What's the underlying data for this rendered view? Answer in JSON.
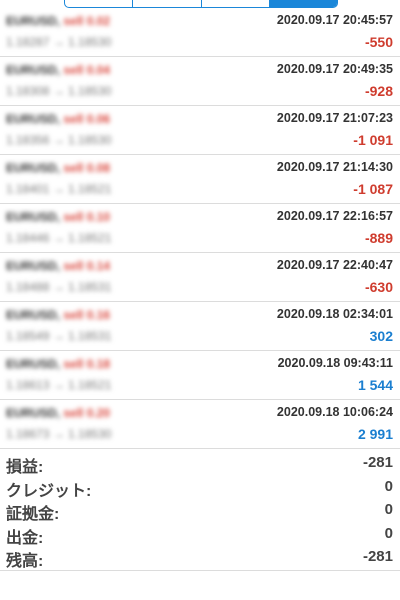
{
  "deals": [
    {
      "symbol": "EURUSD,",
      "side": "sell 0.02",
      "prices": "1.18287 → 1.18530",
      "time": "2020.09.17 20:45:57",
      "profit": "-550",
      "positive": false
    },
    {
      "symbol": "EURUSD,",
      "side": "sell 0.04",
      "prices": "1.18308 → 1.18530",
      "time": "2020.09.17 20:49:35",
      "profit": "-928",
      "positive": false
    },
    {
      "symbol": "EURUSD,",
      "side": "sell 0.06",
      "prices": "1.18356 → 1.18530",
      "time": "2020.09.17 21:07:23",
      "profit": "-1 091",
      "positive": false
    },
    {
      "symbol": "EURUSD,",
      "side": "sell 0.08",
      "prices": "1.18401 → 1.18521",
      "time": "2020.09.17 21:14:30",
      "profit": "-1 087",
      "positive": false
    },
    {
      "symbol": "EURUSD,",
      "side": "sell 0.10",
      "prices": "1.18446 → 1.18521",
      "time": "2020.09.17 22:16:57",
      "profit": "-889",
      "positive": false
    },
    {
      "symbol": "EURUSD,",
      "side": "sell 0.14",
      "prices": "1.18488 → 1.18531",
      "time": "2020.09.17 22:40:47",
      "profit": "-630",
      "positive": false
    },
    {
      "symbol": "EURUSD,",
      "side": "sell 0.16",
      "prices": "1.18549 → 1.18531",
      "time": "2020.09.18 02:34:01",
      "profit": "302",
      "positive": true
    },
    {
      "symbol": "EURUSD,",
      "side": "sell 0.18",
      "prices": "1.18613 → 1.18521",
      "time": "2020.09.18 09:43:11",
      "profit": "1 544",
      "positive": true
    },
    {
      "symbol": "EURUSD,",
      "side": "sell 0.20",
      "prices": "1.18673 → 1.18530",
      "time": "2020.09.18 10:06:24",
      "profit": "2 991",
      "positive": true
    }
  ],
  "summary": [
    {
      "label": "損益:",
      "value": "-281"
    },
    {
      "label": "クレジット:",
      "value": "0"
    },
    {
      "label": "証拠金:",
      "value": "0"
    },
    {
      "label": "出金:",
      "value": "0"
    },
    {
      "label": "残高:",
      "value": "-281"
    }
  ],
  "colors": {
    "accent": "#1b87d9",
    "loss": "#cf3c2e",
    "profit": "#1b7fd0"
  }
}
